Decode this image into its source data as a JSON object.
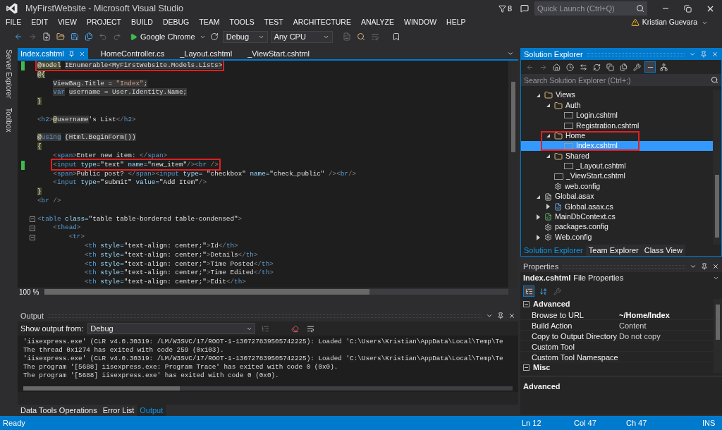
{
  "window": {
    "title": "MyFirstWebsite - Microsoft Visual Studio",
    "notifications": "8",
    "quick_launch": {
      "placeholder": "Quick Launch (Ctrl+Q)"
    },
    "user": "Kristian Guevara"
  },
  "menu": [
    "FILE",
    "EDIT",
    "VIEW",
    "PROJECT",
    "BUILD",
    "DEBUG",
    "TEAM",
    "TOOLS",
    "TEST",
    "ARCHITECTURE",
    "ANALYZE",
    "WINDOW",
    "HELP"
  ],
  "toolbar": {
    "browser": "Google Chrome",
    "configuration": "Debug",
    "platform": "Any CPU"
  },
  "side_tabs": [
    "Server Explorer",
    "Toolbox"
  ],
  "editor": {
    "tabs": [
      {
        "label": "Index.cshtml",
        "selected": true
      },
      {
        "label": "HomeController.cs",
        "selected": false
      },
      {
        "label": "_Layout.cshtml",
        "selected": false
      },
      {
        "label": "_ViewStart.cshtml",
        "selected": false
      }
    ],
    "zoom": "100 %",
    "lines": [
      {
        "kind": "code",
        "changed": true,
        "boxed": true,
        "fold": false,
        "tokens": [
          {
            "text": "@model",
            "kind": "razor"
          },
          {
            "text": " IEnumerable<MyFirstWebsite.Models.Lists>",
            "kind": "cs"
          }
        ]
      },
      {
        "kind": "code",
        "changed": false,
        "boxed": false,
        "fold": false,
        "tokens": [
          {
            "text": "@{",
            "kind": "razor"
          }
        ]
      },
      {
        "kind": "code",
        "changed": false,
        "boxed": false,
        "fold": false,
        "tokens": [
          {
            "text": "    ViewBag.Title = ",
            "kind": "cs"
          },
          {
            "text": "\"Index\"",
            "kind": "csstr"
          },
          {
            "text": ";",
            "kind": "cs"
          }
        ]
      },
      {
        "kind": "code",
        "changed": false,
        "boxed": false,
        "fold": false,
        "tokens": [
          {
            "text": "    var",
            "kind": "cskw"
          },
          {
            "text": " username = User.Identity.Name;",
            "kind": "cs"
          }
        ]
      },
      {
        "kind": "code",
        "changed": false,
        "boxed": false,
        "fold": false,
        "tokens": [
          {
            "text": "}",
            "kind": "razor"
          }
        ]
      },
      {
        "kind": "blank"
      },
      {
        "kind": "code",
        "changed": false,
        "boxed": false,
        "fold": false,
        "tokens": [
          {
            "text": "<",
            "kind": "delim"
          },
          {
            "text": "h2",
            "kind": "tag"
          },
          {
            "text": ">",
            "kind": "delim"
          },
          {
            "text": "@",
            "kind": "razor"
          },
          {
            "text": "username",
            "kind": "cs"
          },
          {
            "text": "'s List",
            "kind": "text"
          },
          {
            "text": "</",
            "kind": "delim"
          },
          {
            "text": "h2",
            "kind": "tag"
          },
          {
            "text": ">",
            "kind": "delim"
          }
        ]
      },
      {
        "kind": "blank"
      },
      {
        "kind": "code",
        "changed": false,
        "boxed": false,
        "fold": false,
        "tokens": [
          {
            "text": "@",
            "kind": "razor"
          },
          {
            "text": "using",
            "kind": "cskw"
          },
          {
            "text": " (Html.BeginForm())",
            "kind": "cs"
          }
        ]
      },
      {
        "kind": "code",
        "changed": false,
        "boxed": false,
        "fold": false,
        "tokens": [
          {
            "text": "{",
            "kind": "razor"
          }
        ]
      },
      {
        "kind": "code",
        "changed": false,
        "boxed": false,
        "fold": false,
        "tokens": [
          {
            "text": "    <",
            "kind": "delim"
          },
          {
            "text": "span",
            "kind": "tag"
          },
          {
            "text": ">",
            "kind": "delim"
          },
          {
            "text": "Enter new item: ",
            "kind": "text"
          },
          {
            "text": "</",
            "kind": "delim"
          },
          {
            "text": "span",
            "kind": "tag"
          },
          {
            "text": ">",
            "kind": "delim"
          }
        ]
      },
      {
        "kind": "code",
        "changed": true,
        "boxed": true,
        "fold": false,
        "tokens": [
          {
            "text": "    <",
            "kind": "delim"
          },
          {
            "text": "input",
            "kind": "tag"
          },
          {
            "text": " type=",
            "kind": "attr"
          },
          {
            "text": "\"text\"",
            "kind": "val"
          },
          {
            "text": " name=",
            "kind": "attr"
          },
          {
            "text": "\"new_item\"",
            "kind": "val"
          },
          {
            "text": "/><",
            "kind": "delim"
          },
          {
            "text": "br",
            "kind": "tag"
          },
          {
            "text": " />",
            "kind": "delim"
          }
        ]
      },
      {
        "kind": "code",
        "changed": false,
        "boxed": false,
        "fold": false,
        "tokens": [
          {
            "text": "    <",
            "kind": "delim"
          },
          {
            "text": "span",
            "kind": "tag"
          },
          {
            "text": ">",
            "kind": "delim"
          },
          {
            "text": "Public post? ",
            "kind": "text"
          },
          {
            "text": "</",
            "kind": "delim"
          },
          {
            "text": "span",
            "kind": "tag"
          },
          {
            "text": "><",
            "kind": "delim"
          },
          {
            "text": "input",
            "kind": "tag"
          },
          {
            "text": " type= ",
            "kind": "attr"
          },
          {
            "text": "\"checkbox\"",
            "kind": "val"
          },
          {
            "text": " name=",
            "kind": "attr"
          },
          {
            "text": "\"check_public\"",
            "kind": "val"
          },
          {
            "text": " /><",
            "kind": "delim"
          },
          {
            "text": "br",
            "kind": "tag"
          },
          {
            "text": "/>",
            "kind": "delim"
          }
        ]
      },
      {
        "kind": "code",
        "changed": false,
        "boxed": false,
        "fold": false,
        "tokens": [
          {
            "text": "    <",
            "kind": "delim"
          },
          {
            "text": "input",
            "kind": "tag"
          },
          {
            "text": " type=",
            "kind": "attr"
          },
          {
            "text": "\"submit\"",
            "kind": "val"
          },
          {
            "text": " value=",
            "kind": "attr"
          },
          {
            "text": "\"Add Item\"",
            "kind": "val"
          },
          {
            "text": "/>",
            "kind": "delim"
          }
        ]
      },
      {
        "kind": "code",
        "changed": false,
        "boxed": false,
        "fold": false,
        "tokens": [
          {
            "text": "}",
            "kind": "razor"
          }
        ]
      },
      {
        "kind": "code",
        "changed": false,
        "boxed": false,
        "fold": false,
        "tokens": [
          {
            "text": "<",
            "kind": "delim"
          },
          {
            "text": "br",
            "kind": "tag"
          },
          {
            "text": " />",
            "kind": "delim"
          }
        ]
      },
      {
        "kind": "blank"
      },
      {
        "kind": "code",
        "changed": false,
        "boxed": false,
        "fold": true,
        "tokens": [
          {
            "text": "<",
            "kind": "delim"
          },
          {
            "text": "table",
            "kind": "tag"
          },
          {
            "text": " class=",
            "kind": "attr"
          },
          {
            "text": "\"table table-bordered table-condensed\"",
            "kind": "val"
          },
          {
            "text": ">",
            "kind": "delim"
          }
        ]
      },
      {
        "kind": "code",
        "changed": false,
        "boxed": false,
        "fold": true,
        "tokens": [
          {
            "text": "    <",
            "kind": "delim"
          },
          {
            "text": "thead",
            "kind": "tag"
          },
          {
            "text": ">",
            "kind": "delim"
          }
        ]
      },
      {
        "kind": "code",
        "changed": false,
        "boxed": false,
        "fold": true,
        "tokens": [
          {
            "text": "        <",
            "kind": "delim"
          },
          {
            "text": "tr",
            "kind": "tag"
          },
          {
            "text": ">",
            "kind": "delim"
          }
        ]
      },
      {
        "kind": "code",
        "changed": false,
        "boxed": false,
        "fold": false,
        "tokens": [
          {
            "text": "            <",
            "kind": "delim"
          },
          {
            "text": "th",
            "kind": "tag"
          },
          {
            "text": " style=",
            "kind": "attr"
          },
          {
            "text": "\"text-align: center;\"",
            "kind": "val"
          },
          {
            "text": ">",
            "kind": "delim"
          },
          {
            "text": "Id",
            "kind": "text"
          },
          {
            "text": "</",
            "kind": "delim"
          },
          {
            "text": "th",
            "kind": "tag"
          },
          {
            "text": ">",
            "kind": "delim"
          }
        ]
      },
      {
        "kind": "code",
        "changed": false,
        "boxed": false,
        "fold": false,
        "tokens": [
          {
            "text": "            <",
            "kind": "delim"
          },
          {
            "text": "th",
            "kind": "tag"
          },
          {
            "text": " style=",
            "kind": "attr"
          },
          {
            "text": "\"text-align: center;\"",
            "kind": "val"
          },
          {
            "text": ">",
            "kind": "delim"
          },
          {
            "text": "Details",
            "kind": "text"
          },
          {
            "text": "</",
            "kind": "delim"
          },
          {
            "text": "th",
            "kind": "tag"
          },
          {
            "text": ">",
            "kind": "delim"
          }
        ]
      },
      {
        "kind": "code",
        "changed": false,
        "boxed": false,
        "fold": false,
        "tokens": [
          {
            "text": "            <",
            "kind": "delim"
          },
          {
            "text": "th",
            "kind": "tag"
          },
          {
            "text": " style=",
            "kind": "attr"
          },
          {
            "text": "\"text-align: center;\"",
            "kind": "val"
          },
          {
            "text": ">",
            "kind": "delim"
          },
          {
            "text": "Time Posted",
            "kind": "text"
          },
          {
            "text": "</",
            "kind": "delim"
          },
          {
            "text": "th",
            "kind": "tag"
          },
          {
            "text": ">",
            "kind": "delim"
          }
        ]
      },
      {
        "kind": "code",
        "changed": false,
        "boxed": false,
        "fold": false,
        "tokens": [
          {
            "text": "            <",
            "kind": "delim"
          },
          {
            "text": "th",
            "kind": "tag"
          },
          {
            "text": " style=",
            "kind": "attr"
          },
          {
            "text": "\"text-align: center;\"",
            "kind": "val"
          },
          {
            "text": ">",
            "kind": "delim"
          },
          {
            "text": "Time Edited",
            "kind": "text"
          },
          {
            "text": "</",
            "kind": "delim"
          },
          {
            "text": "th",
            "kind": "tag"
          },
          {
            "text": ">",
            "kind": "delim"
          }
        ]
      },
      {
        "kind": "code",
        "changed": false,
        "boxed": false,
        "fold": false,
        "tokens": [
          {
            "text": "            <",
            "kind": "delim"
          },
          {
            "text": "th",
            "kind": "tag"
          },
          {
            "text": " style=",
            "kind": "attr"
          },
          {
            "text": "\"text-align: center;\"",
            "kind": "val"
          },
          {
            "text": ">",
            "kind": "delim"
          },
          {
            "text": "Edit",
            "kind": "text"
          },
          {
            "text": "</",
            "kind": "delim"
          },
          {
            "text": "th",
            "kind": "tag"
          },
          {
            "text": ">",
            "kind": "delim"
          }
        ]
      }
    ]
  },
  "output": {
    "title": "Output",
    "source_label": "Show output from:",
    "source": "Debug",
    "lines": [
      "'iisexpress.exe' (CLR v4.0.30319: /LM/W3SVC/17/ROOT-1-130727839505742225): Loaded 'C:\\Users\\Kristian\\AppData\\Local\\Temp\\Te",
      "The thread 0x1274 has exited with code 259 (0x103).",
      "'iisexpress.exe' (CLR v4.0.30319: /LM/W3SVC/17/ROOT-1-130727839505742225): Loaded 'C:\\Users\\Kristian\\AppData\\Local\\Temp\\Te",
      "The program '[5688] iisexpress.exe: Program Trace' has exited with code 0 (0x0).",
      "The program '[5688] iisexpress.exe' has exited with code 0 (0x0)."
    ],
    "tabs": [
      {
        "label": "Data Tools Operations",
        "selected": false
      },
      {
        "label": "Error List",
        "selected": false
      },
      {
        "label": "Output",
        "selected": true
      }
    ]
  },
  "solution_explorer": {
    "title": "Solution Explorer",
    "search": {
      "placeholder": "Search Solution Explorer (Ctrl+;)"
    },
    "tree": [
      {
        "label": "Views",
        "kind": "folder",
        "expanded": true,
        "children": [
          {
            "label": "Auth",
            "kind": "folder",
            "expanded": true,
            "children": [
              {
                "label": "Login.cshtml",
                "kind": "razor",
                "selected": false
              },
              {
                "label": "Registration.cshtml",
                "kind": "razor",
                "selected": false
              }
            ]
          },
          {
            "label": "Home",
            "kind": "folder",
            "expanded": true,
            "boxed": true,
            "children": [
              {
                "label": "Index.cshtml",
                "kind": "razor",
                "selected": true
              }
            ]
          },
          {
            "label": "Shared",
            "kind": "folder",
            "expanded": true,
            "children": [
              {
                "label": "_Layout.cshtml",
                "kind": "razor",
                "selected": false
              }
            ]
          },
          {
            "label": "_ViewStart.cshtml",
            "kind": "razor",
            "selected": false
          },
          {
            "label": "web.config",
            "kind": "config",
            "selected": false
          }
        ]
      },
      {
        "label": "Global.asax",
        "kind": "asax",
        "expanded": true,
        "children": [
          {
            "label": "Global.asax.cs",
            "kind": "code",
            "expanded": false,
            "selected": false
          }
        ]
      },
      {
        "label": "MainDbContext.cs",
        "kind": "csharp",
        "expanded": false,
        "selected": false
      },
      {
        "label": "packages.config",
        "kind": "config",
        "selected": false
      },
      {
        "label": "Web.config",
        "kind": "config",
        "expanded": false,
        "selected": false
      }
    ],
    "tabs": [
      {
        "label": "Solution Explorer",
        "selected": true
      },
      {
        "label": "Team Explorer",
        "selected": false
      },
      {
        "label": "Class View",
        "selected": false
      }
    ]
  },
  "properties": {
    "title": "Properties",
    "object": "Index.cshtml",
    "object_type": "File Properties",
    "categories": [
      {
        "name": "Advanced",
        "expanded": true,
        "rows": [
          {
            "name": "Browse to URL",
            "value": "~/Home/Index",
            "modified": true
          },
          {
            "name": "Build Action",
            "value": "Content",
            "modified": false
          },
          {
            "name": "Copy to Output Directory",
            "value": "Do not copy",
            "modified": false
          },
          {
            "name": "Custom Tool"
          },
          {
            "name": "Custom Tool Namespace"
          }
        ]
      },
      {
        "name": "Misc",
        "expanded": true
      }
    ],
    "description": "Advanced"
  },
  "status_bar": {
    "message": "Ready",
    "line": "Ln 12",
    "column": "Col 47",
    "char": "Ch 47",
    "mode": "INS"
  }
}
